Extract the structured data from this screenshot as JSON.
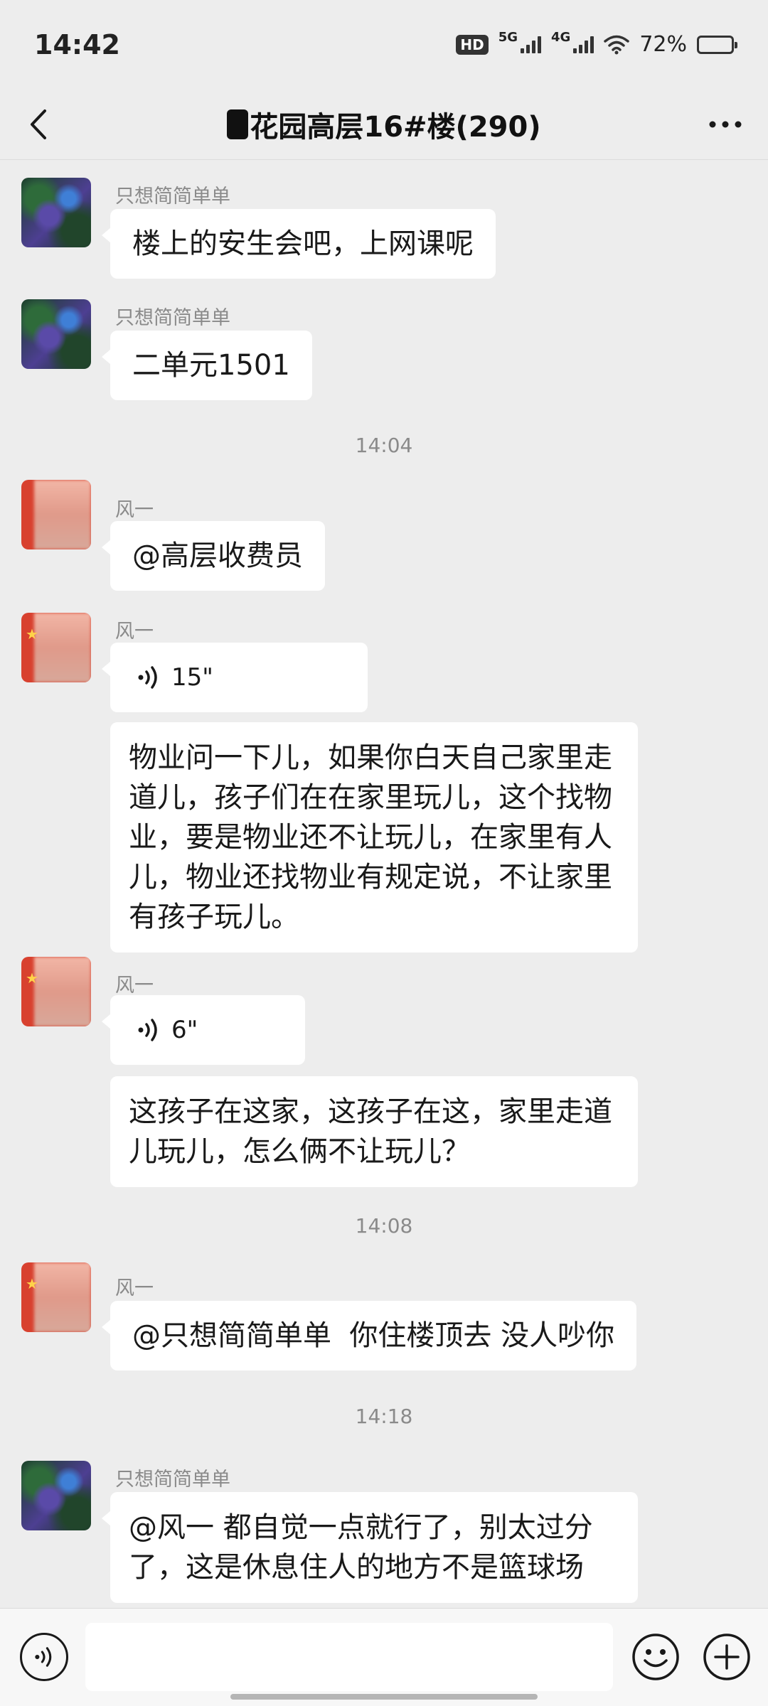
{
  "status_bar": {
    "time": "14:42",
    "hd_label": "HD",
    "network_5g": "5G",
    "network_4g": "4G",
    "battery": "72%",
    "battery_level": 0.72
  },
  "header": {
    "title": "花园高层16#楼(290)",
    "back_icon": "chevron-left-icon",
    "more_icon": "more-horizontal-icon"
  },
  "messages": [
    {
      "sender": "只想简简单单",
      "text": "楼上的安生会吧，上网课呢"
    },
    {
      "sender": "只想简简单单",
      "text": "二单元1501"
    },
    {
      "timestamp": "14:04"
    },
    {
      "sender": "风一",
      "text": "@高层收费员"
    },
    {
      "sender": "风一",
      "voice_duration": "15\""
    },
    {
      "text": "物业问一下儿，如果你白天自己家里走道儿，孩子们在在家里玩儿，这个找物业，要是物业还不让玩儿，在家里有人儿，物业还找物业有规定说，不让家里有孩子玩儿。"
    },
    {
      "sender": "风一",
      "voice_duration": "6\""
    },
    {
      "text": "这孩子在这家，这孩子在这，家里走道儿玩儿，怎么俩不让玩儿？"
    },
    {
      "timestamp": "14:08"
    },
    {
      "sender": "风一",
      "text": "@只想简简单单  你住楼顶去 没人吵你"
    },
    {
      "timestamp": "14:18"
    },
    {
      "sender": "只想简简单单",
      "text": "@风一  都自觉一点就行了，别太过分了，这是休息住人的地方不是篮球场"
    }
  ],
  "input_bar": {
    "voice_icon": "voice-input-icon",
    "emoji_icon": "emoji-icon",
    "plus_icon": "plus-circle-icon",
    "text_value": ""
  }
}
